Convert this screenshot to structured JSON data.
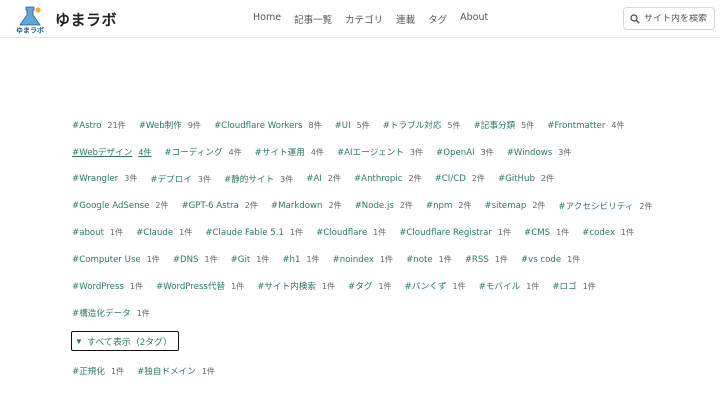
{
  "site": {
    "name": "ゆまラボ",
    "logo_text": "ゆまラボ"
  },
  "nav": {
    "items": [
      "Home",
      "記事一覧",
      "カテゴリ",
      "連載",
      "タグ",
      "About"
    ]
  },
  "search": {
    "placeholder": "サイト内を検索"
  },
  "colors": {
    "accent": "#2d7a5a",
    "count": "#666666"
  },
  "tag_rows": [
    [
      {
        "name": "#Astro",
        "count": "21件"
      },
      {
        "name": "#Web制作",
        "count": "9件"
      },
      {
        "name": "#Cloudflare Workers",
        "count": "8件"
      },
      {
        "name": "#UI",
        "count": "5件"
      },
      {
        "name": "#トラブル対応",
        "count": "5件"
      },
      {
        "name": "#記事分類",
        "count": "5件"
      },
      {
        "name": "#Frontmatter",
        "count": "4件"
      }
    ],
    [
      {
        "name": "#Webデザイン",
        "count": "4件"
      },
      {
        "name": "#コーディング",
        "count": "4件"
      },
      {
        "name": "#サイト運用",
        "count": "4件"
      },
      {
        "name": "#AIエージェント",
        "count": "3件"
      },
      {
        "name": "#OpenAI",
        "count": "3件"
      },
      {
        "name": "#Windows",
        "count": "3件"
      }
    ],
    [
      {
        "name": "#Wrangler",
        "count": "3件"
      },
      {
        "name": "#デプロイ",
        "count": "3件"
      },
      {
        "name": "#静的サイト",
        "count": "3件"
      },
      {
        "name": "#AI",
        "count": "2件"
      },
      {
        "name": "#Anthropic",
        "count": "2件"
      },
      {
        "name": "#CI/CD",
        "count": "2件"
      },
      {
        "name": "#GitHub",
        "count": "2件"
      }
    ],
    [
      {
        "name": "#Google AdSense",
        "count": "2件"
      },
      {
        "name": "#GPT-6 Astra",
        "count": "2件"
      },
      {
        "name": "#Markdown",
        "count": "2件"
      },
      {
        "name": "#Node.js",
        "count": "2件"
      },
      {
        "name": "#npm",
        "count": "2件"
      },
      {
        "name": "#sitemap",
        "count": "2件"
      },
      {
        "name": "#アクセシビリティ",
        "count": "2件"
      }
    ],
    [
      {
        "name": "#about",
        "count": "1件"
      },
      {
        "name": "#Claude",
        "count": "1件"
      },
      {
        "name": "#Claude Fable 5.1",
        "count": "1件"
      },
      {
        "name": "#Cloudflare",
        "count": "1件"
      },
      {
        "name": "#Cloudflare Registrar",
        "count": "1件"
      },
      {
        "name": "#CMS",
        "count": "1件"
      },
      {
        "name": "#codex",
        "count": "1件"
      }
    ],
    [
      {
        "name": "#Computer Use",
        "count": "1件"
      },
      {
        "name": "#DNS",
        "count": "1件"
      },
      {
        "name": "#Git",
        "count": "1件"
      },
      {
        "name": "#h1",
        "count": "1件"
      },
      {
        "name": "#noindex",
        "count": "1件"
      },
      {
        "name": "#note",
        "count": "1件"
      },
      {
        "name": "#RSS",
        "count": "1件"
      },
      {
        "name": "#vs code",
        "count": "1件"
      }
    ],
    [
      {
        "name": "#WordPress",
        "count": "1件"
      },
      {
        "name": "#WordPress代替",
        "count": "1件"
      },
      {
        "name": "#サイト内検索",
        "count": "1件"
      },
      {
        "name": "#タグ",
        "count": "1件"
      },
      {
        "name": "#パンくず",
        "count": "1件"
      },
      {
        "name": "#モバイル",
        "count": "1件"
      },
      {
        "name": "#ロゴ",
        "count": "1件"
      }
    ],
    [
      {
        "name": "#構造化データ",
        "count": "1件"
      }
    ]
  ],
  "toggle": {
    "label": "すべて表示（2タグ）"
  },
  "extra_tags": [
    {
      "name": "#正規化",
      "count": "1件"
    },
    {
      "name": "#独自ドメイン",
      "count": "1件"
    }
  ]
}
